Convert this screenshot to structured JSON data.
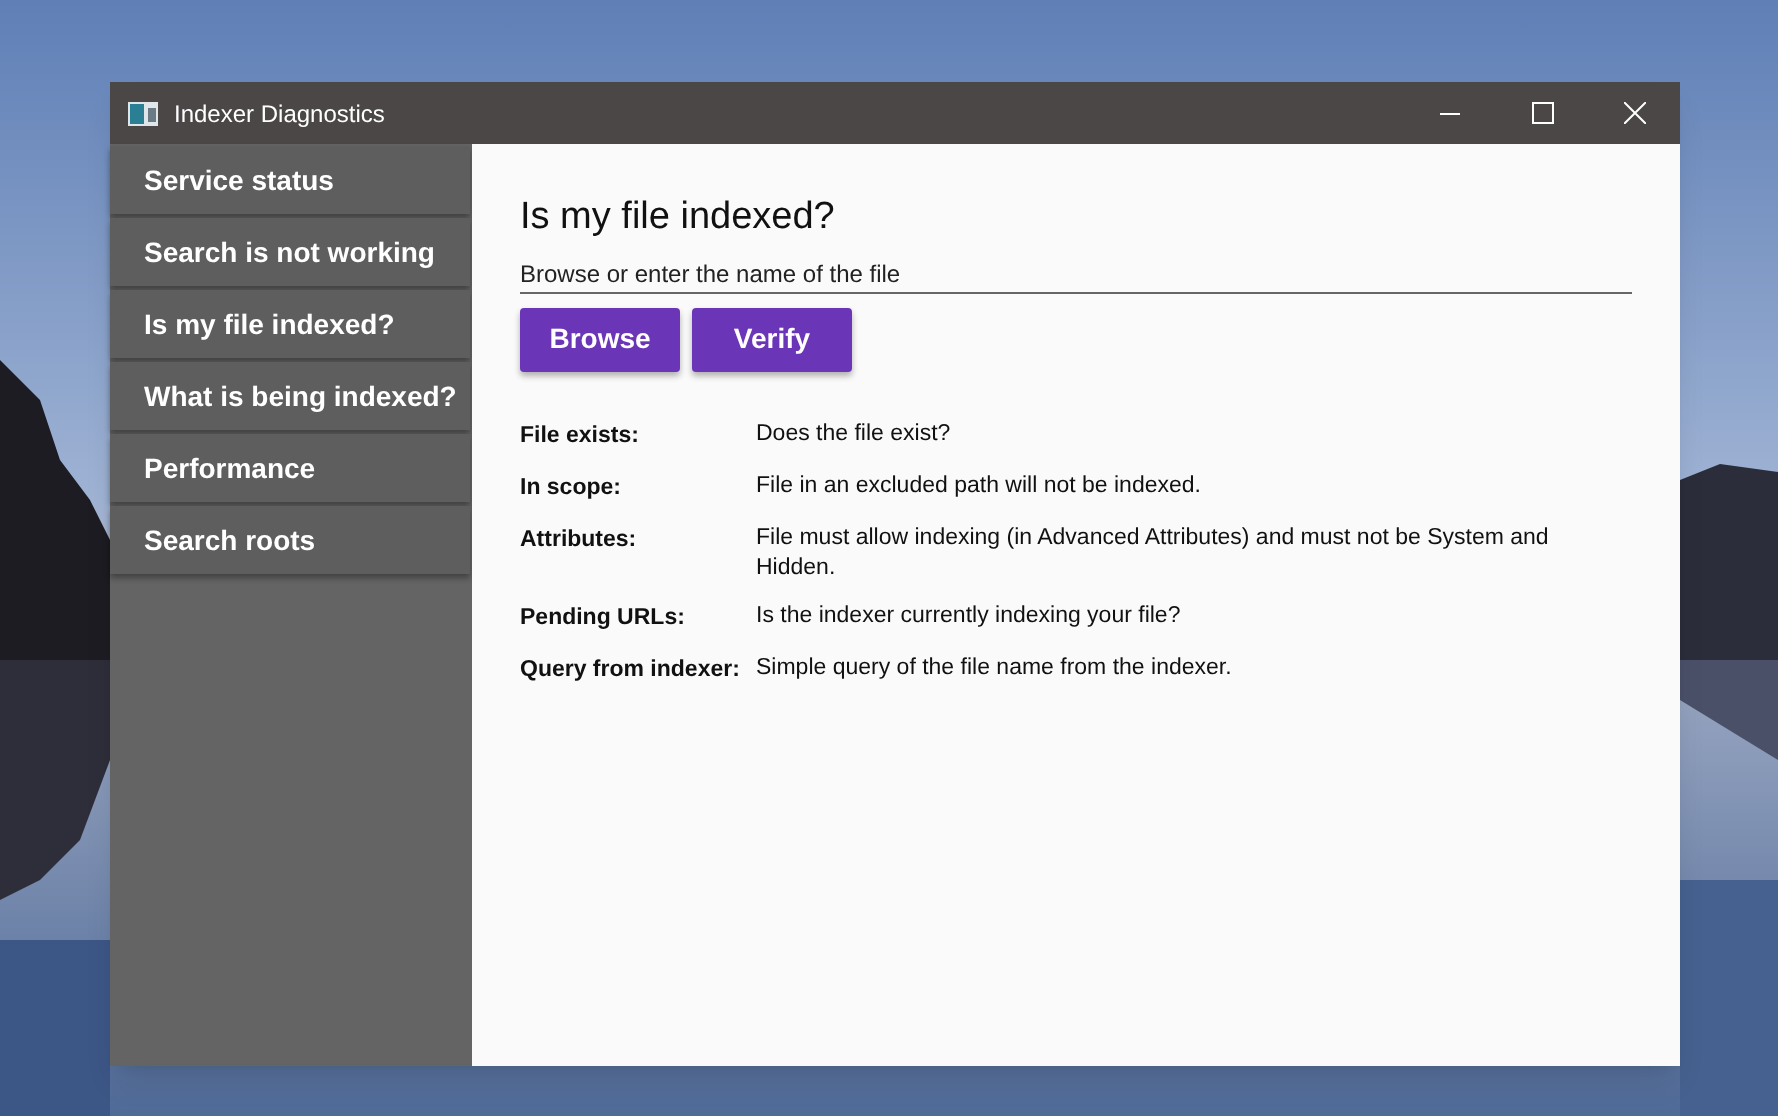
{
  "window": {
    "title": "Indexer Diagnostics"
  },
  "sidebar": {
    "items": [
      {
        "label": "Service status"
      },
      {
        "label": "Search is not working"
      },
      {
        "label": "Is my file indexed?"
      },
      {
        "label": "What is being indexed?"
      },
      {
        "label": "Performance"
      },
      {
        "label": "Search roots"
      }
    ]
  },
  "content": {
    "heading": "Is my file indexed?",
    "file_field": {
      "placeholder": "Browse or enter the name of the file"
    },
    "buttons": [
      "Browse",
      "Verify"
    ],
    "results": [
      {
        "label": "File exists:",
        "text": "Does the file exist?"
      },
      {
        "label": "In scope:",
        "text": "File in an excluded path will not be indexed."
      },
      {
        "label": "Attributes:",
        "text": "File must allow indexing (in Advanced Attributes) and must not be System and Hidden."
      },
      {
        "label": "Pending URLs:",
        "text": "Is the indexer currently indexing your file?"
      },
      {
        "label": "Query from indexer:",
        "text": "Simple query of the file name from the indexer."
      }
    ]
  }
}
